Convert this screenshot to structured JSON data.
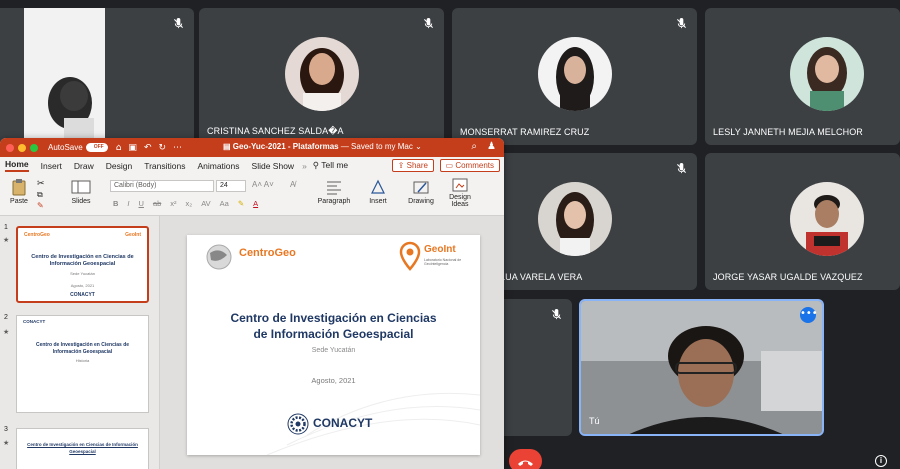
{
  "participants": [
    {
      "name": "CRISTINA SANCHEZ SALDA�A",
      "muted": true
    },
    {
      "name": "MONSERRAT RAMIREZ CRUZ",
      "muted": true
    },
    {
      "name": "LESLY JANNETH MEJIA MELCHOR",
      "muted": true
    },
    {
      "name": "LUA VARELA VERA",
      "muted": true
    },
    {
      "name": "JORGE YASAR UGALDE VAZQUEZ",
      "muted": true
    },
    {
      "name": "Tú",
      "muted": false
    }
  ],
  "powerpoint": {
    "autosave_label": "AutoSave",
    "autosave_state": "OFF",
    "doc_title": "Geo-Yuc-2021 - Plataformas",
    "doc_saved": " — Saved to my Mac ⌄",
    "tabs": [
      "Home",
      "Insert",
      "Draw",
      "Design",
      "Transitions",
      "Animations",
      "Slide Show",
      "»",
      "Tell me"
    ],
    "share_label": "Share",
    "comments_label": "Comments",
    "ribbon": {
      "paste": "Paste",
      "slides": "Slides",
      "font": "Calibri (Body)",
      "size": "24",
      "paragraph": "Paragraph",
      "insert": "Insert",
      "drawing": "Drawing",
      "design_ideas": "Design Ideas"
    },
    "thumbnails": [
      {
        "num": "1",
        "title": "Centro de Investigación en Ciencias de Información Geoespacial",
        "sub": "Sede Yucatán",
        "date": "Agosto, 2021"
      },
      {
        "num": "2",
        "title": "Centro de Investigación en Ciencias de Información Geoespacial",
        "sub": "Historia"
      },
      {
        "num": "3",
        "title": "Centro de Investigación en Ciencias de Información Geoespacial"
      }
    ],
    "slide": {
      "logo_left": "CentroGeo",
      "logo_right": "GeoInt",
      "logo_right_sub": "Laboratorio Nacional de GeoInteligencia",
      "title_line1": "Centro de Investigación en Ciencias",
      "title_line2": "de Información Geoespacial",
      "subtitle": "Sede Yucatán",
      "date": "Agosto, 2021",
      "footer_logo": "CONACYT"
    }
  },
  "colors": {
    "meet_bg": "#202124",
    "tile_bg": "#3c4043",
    "ppt_accent": "#c43e1c",
    "slide_title": "#1f3864",
    "active_border": "#8ab4f8",
    "end_call": "#ea4335"
  }
}
